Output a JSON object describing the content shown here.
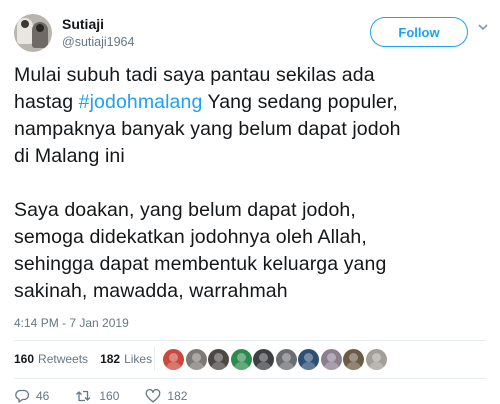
{
  "user": {
    "name": "Sutiaji",
    "handle": "@sutiaji1964"
  },
  "follow_label": "Follow",
  "tweet": {
    "line1": "Mulai subuh tadi saya pantau sekilas ada",
    "line2_prefix": "hastag ",
    "hashtag": "#jodohmalang",
    "line2_suffix": " Yang sedang populer,",
    "line3": "nampaknya banyak yang belum dapat jodoh",
    "line4": "di Malang ini",
    "line5": "Saya doakan, yang belum dapat jodoh,",
    "line6": "semoga didekatkan jodohnya oleh Allah,",
    "line7": "sehingga dapat membentuk keluarga yang",
    "line8": "sakinah, mawadda, warrahmah"
  },
  "timestamp": "4:14 PM - 7 Jan 2019",
  "stats": {
    "retweets_count": "160",
    "retweets_label": "Retweets",
    "likes_count": "182",
    "likes_label": "Likes"
  },
  "likers": [
    {
      "icon": "liker-avatar-1",
      "color": "#c94a3c"
    },
    {
      "icon": "liker-avatar-2",
      "color": "#7d7a76"
    },
    {
      "icon": "liker-avatar-3",
      "color": "#4a4744"
    },
    {
      "icon": "liker-avatar-4",
      "color": "#2f8a4f"
    },
    {
      "icon": "liker-avatar-5",
      "color": "#3d3f44"
    },
    {
      "icon": "liker-avatar-6",
      "color": "#6a6d72"
    },
    {
      "icon": "liker-avatar-7",
      "color": "#2c4f73"
    },
    {
      "icon": "liker-avatar-8",
      "color": "#8b7f8f"
    },
    {
      "icon": "liker-avatar-9",
      "color": "#6b5b45"
    },
    {
      "icon": "liker-avatar-10",
      "color": "#a39e97"
    }
  ],
  "actions": {
    "reply_count": "46",
    "retweet_count": "160",
    "like_count": "182"
  },
  "colors": {
    "accent": "#1da1f2",
    "muted": "#657786",
    "text": "#14171a"
  }
}
